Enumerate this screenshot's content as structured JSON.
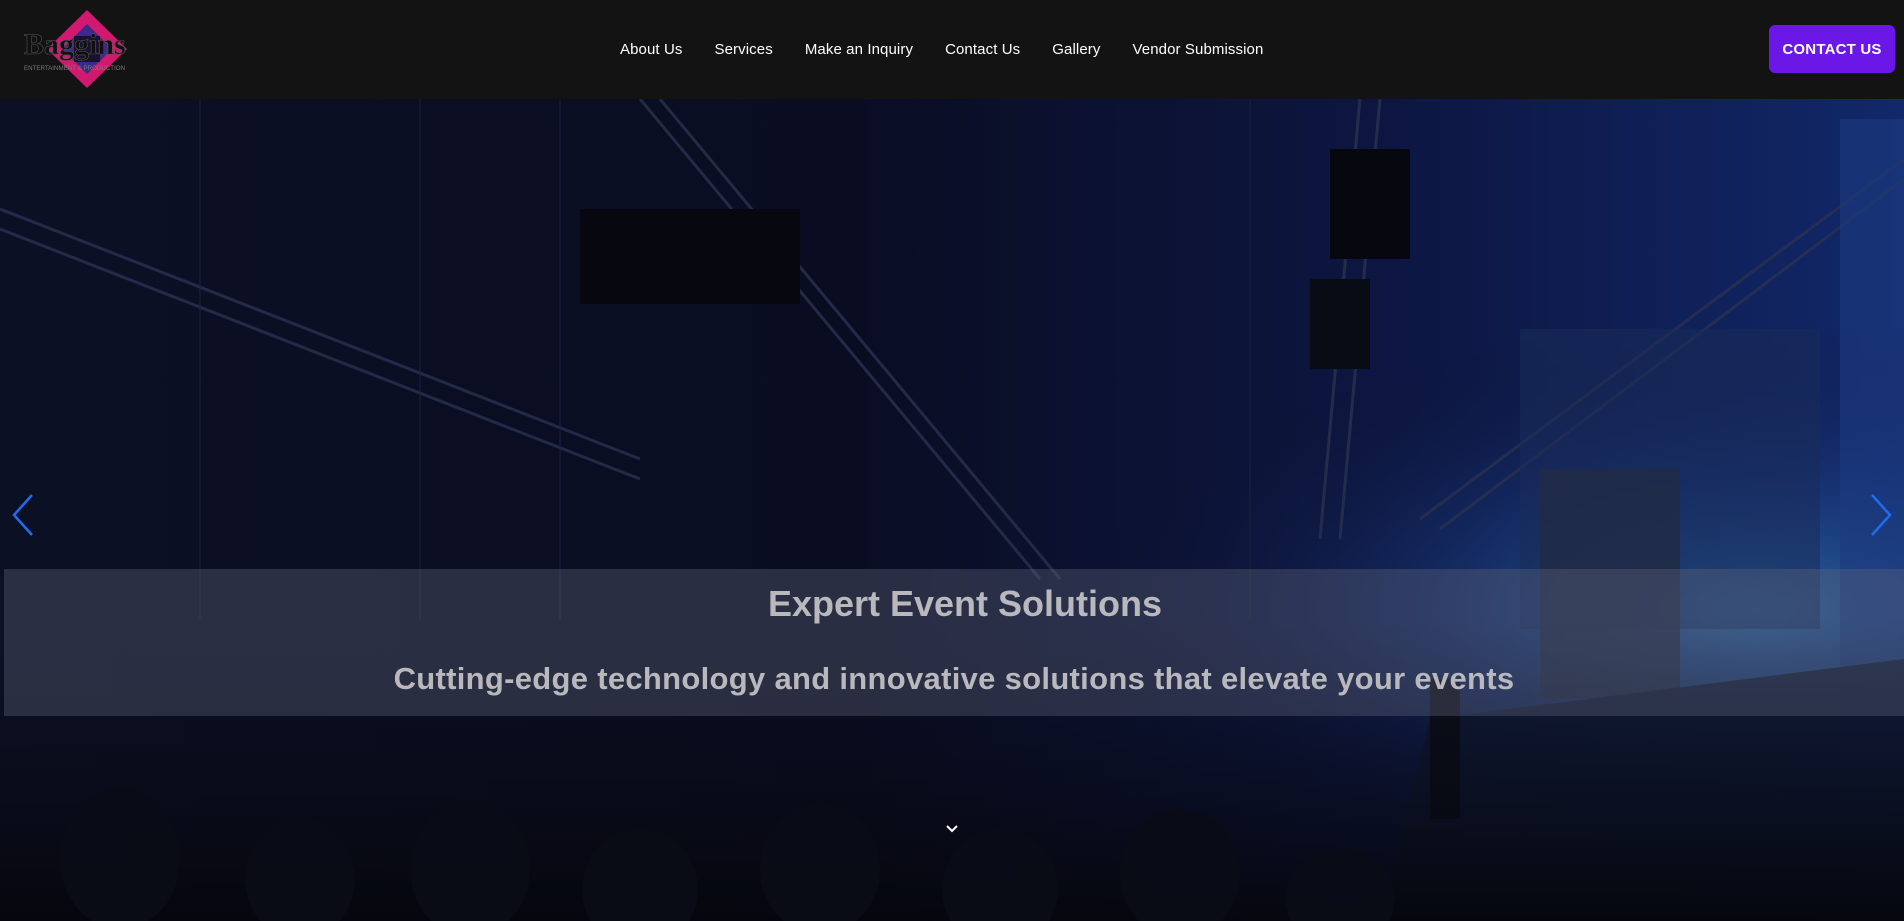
{
  "brand": {
    "logo_text": "Baggins",
    "logo_tagline": "ENTERTAINMENT & PRODUCTION",
    "accent_pink": "#d0196f",
    "accent_purple": "#3b2a8c"
  },
  "nav": {
    "items": [
      {
        "label": "About Us"
      },
      {
        "label": "Services"
      },
      {
        "label": "Make an Inquiry"
      },
      {
        "label": "Contact Us"
      },
      {
        "label": "Gallery"
      },
      {
        "label": "Vendor Submission"
      }
    ]
  },
  "header": {
    "cta_label": "CONTACT US",
    "cta_color": "#6a17e8"
  },
  "hero": {
    "title": "Expert Event Solutions",
    "subtitle": "Cutting-edge technology and innovative solutions that elevate your events",
    "prev_icon": "chevron-left-icon",
    "next_icon": "chevron-right-icon",
    "scroll_icon": "chevron-down-icon",
    "arrow_color": "#1e6cf0"
  }
}
